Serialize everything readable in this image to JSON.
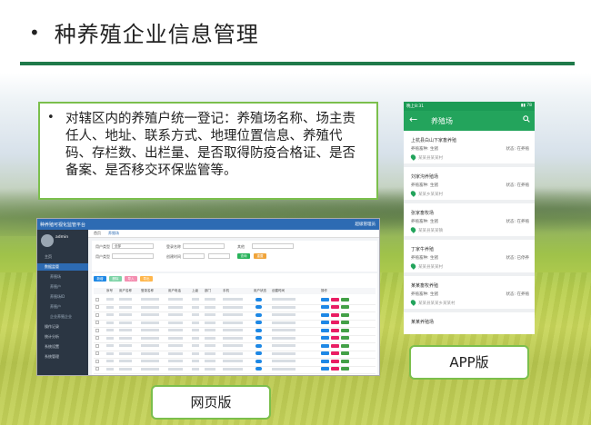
{
  "slide": {
    "title_bullet": "•",
    "title": "种养殖企业信息管理",
    "body_bullet": "•",
    "body_text": "对辖区内的养殖户统一登记：养殖场名称、场主责任人、地址、联系方式、地理位置信息、养殖代码、存栏数、出栏量、是否取得防疫合格证、是否备案、是否移交环保监管等。",
    "web_label": "网页版",
    "app_label": "APP版"
  },
  "colors": {
    "title_rule": "#1f7a4a",
    "box_border": "#7bbf4c",
    "web_header": "#2d6bb3",
    "web_sidebar": "#2b3643",
    "app_header": "#23a45c"
  },
  "web": {
    "title": "种养殖可视化监管平台",
    "top_right": "超级管理员",
    "user": "admin",
    "menu": [
      {
        "label": "主页",
        "state": "normal"
      },
      {
        "label": "数据监管",
        "state": "active"
      },
      {
        "label": "养殖场",
        "state": "sub"
      },
      {
        "label": "养殖户",
        "state": "sub"
      },
      {
        "label": "养殖场ID",
        "state": "sub"
      },
      {
        "label": "养殖户",
        "state": "sub"
      },
      {
        "label": "企业养殖企业",
        "state": "sub"
      },
      {
        "label": "操作记录",
        "state": "normal"
      },
      {
        "label": "统计分析",
        "state": "normal"
      },
      {
        "label": "系统设置",
        "state": "normal"
      },
      {
        "label": "系统管理",
        "state": "normal"
      }
    ],
    "tabs": [
      "首页",
      "养殖场"
    ],
    "filters": {
      "user_type": "用户类型",
      "user_type_value": "全部",
      "registered_name": "登录名称",
      "register_time": "创建时间",
      "other": "其他",
      "search": "查询",
      "reset": "重置"
    },
    "actions": [
      "新增",
      "删除",
      "导入",
      "导出"
    ],
    "columns": [
      "",
      "序号",
      "用户名称",
      "登录名称",
      "用户电话",
      "上级",
      "部门",
      "手机",
      "用户状态",
      "创建时间",
      "",
      "操作"
    ]
  },
  "app": {
    "status_time": "晚上8:31",
    "status_right": "▮▮ 78",
    "title": "养殖场",
    "items": [
      {
        "name": "上杭县白山下家畜养殖",
        "type": "养殖畜种: 生猪",
        "status": "状态: 在养殖",
        "loc": "某某县某某村"
      },
      {
        "name": "刘家沟养殖场",
        "type": "养殖畜种: 生猪",
        "status": "状态: 在养殖",
        "loc": "某某乡某某村"
      },
      {
        "name": "张家畜牧场",
        "type": "养殖畜种: 生猪",
        "status": "状态: 在养殖",
        "loc": "某某县某某镇"
      },
      {
        "name": "丁家牛养殖",
        "type": "养殖畜种: 生猪",
        "status": "状态: 已停养",
        "loc": "某某县某某村"
      },
      {
        "name": "某某畜牧养殖",
        "type": "养殖畜种: 生猪",
        "status": "状态: 在养殖",
        "loc": "某某县某某乡某某村"
      },
      {
        "name": "某某养殖场",
        "type": "",
        "status": "",
        "loc": ""
      }
    ]
  }
}
